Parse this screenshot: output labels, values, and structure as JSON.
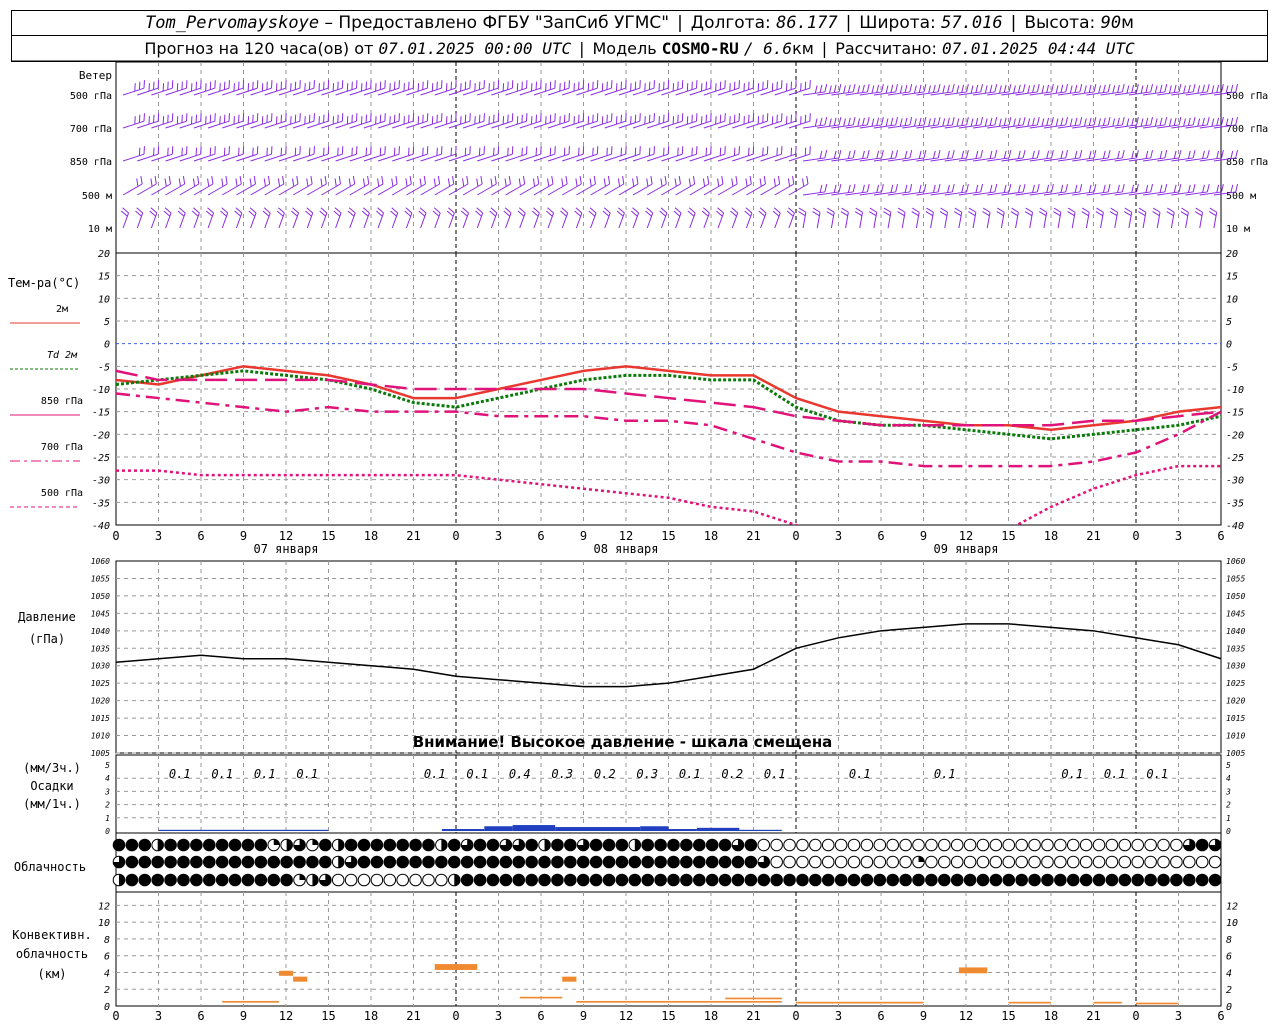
{
  "header": {
    "station": "Tom_Pervomayskoye",
    "provided": "– Предоставлено ФГБУ \"ЗапСиб УГМС\"",
    "lon_label": "Долгота:",
    "lon": "86.177",
    "lat_label": "Широта:",
    "lat": "57.016",
    "alt_label": "Высота:",
    "alt": "90",
    "alt_unit": "м",
    "forecast_label": "Прогноз на 120 часа(ов) от",
    "forecast_start": "07.01.2025 00:00 UTC",
    "model_label": "Модель",
    "model": "COSMO-RU",
    "resolution": "/ 6.6",
    "resolution_unit": "км",
    "calc_label": "Рассчитано:",
    "calc_time": "07.01.2025 04:44 UTC"
  },
  "labels": {
    "wind": "Ветер",
    "wind_levels": [
      "500 гПа",
      "700 гПа",
      "850 гПа",
      "500 м",
      "10  м"
    ],
    "temp_title": "Тем-ра(°С)",
    "legend": [
      "2м",
      "Td  2м",
      "850 гПа",
      "700 гПа",
      "500 гПа"
    ],
    "pressure": "Давление",
    "pressure_unit": "(гПа)",
    "pressure_warning": "Внимание! Высокое давление - шкала смещена",
    "precip_unit_3h": "(мм/3ч.)",
    "precip": "Осадки",
    "precip_unit_1h": "(мм/1ч.)",
    "cloud": "Облачность",
    "conv1": "Конвективн.",
    "conv2": "облачность",
    "conv3": "(км)",
    "days": [
      "07 января",
      "08 января",
      "09 января"
    ]
  },
  "colors": {
    "t2m": "#e8382f",
    "td2m": "#0a7a0a",
    "t850": "#e0137a",
    "t700": "#e0137a",
    "t500": "#e0137a",
    "wind": "#8a2be2",
    "precip": "#2040c0",
    "conv": "#f08a30",
    "zero": "#4060e0"
  },
  "chart_data": [
    {
      "type": "line",
      "title": "Тем-ра(°С)",
      "x": [
        0,
        3,
        6,
        9,
        12,
        15,
        18,
        21,
        24,
        27,
        30,
        33,
        36,
        39,
        42,
        45,
        48,
        51,
        54,
        57,
        60,
        63,
        66,
        69,
        72,
        75,
        78
      ],
      "xticks": [
        "0",
        "3",
        "6",
        "9",
        "12",
        "15",
        "18",
        "21",
        "0",
        "3",
        "6",
        "9",
        "12",
        "15",
        "18",
        "21",
        "0",
        "3",
        "6",
        "9",
        "12",
        "15",
        "18",
        "21",
        "0",
        "3",
        "6"
      ],
      "ylim": [
        -40,
        20
      ],
      "yticks": [
        20,
        15,
        10,
        5,
        0,
        -5,
        -10,
        -15,
        -20,
        -25,
        -30,
        -35,
        -40
      ],
      "series": [
        {
          "name": "2м",
          "values": [
            -8,
            -9,
            -7,
            -5,
            -6,
            -7,
            -9,
            -12,
            -12,
            -10,
            -8,
            -6,
            -5,
            -6,
            -7,
            -7,
            -12,
            -15,
            -16,
            -17,
            -18,
            -18,
            -19,
            -18,
            -17,
            -15,
            -14
          ]
        },
        {
          "name": "Td  2м",
          "values": [
            -9,
            -8,
            -7,
            -6,
            -7,
            -8,
            -10,
            -13,
            -14,
            -12,
            -10,
            -8,
            -7,
            -7,
            -8,
            -8,
            -14,
            -17,
            -18,
            -18,
            -19,
            -20,
            -21,
            -20,
            -19,
            -18,
            -16
          ]
        },
        {
          "name": "850 гПа",
          "values": [
            -6,
            -8,
            -8,
            -8,
            -8,
            -8,
            -9,
            -10,
            -10,
            -10,
            -10,
            -10,
            -11,
            -12,
            -13,
            -14,
            -16,
            -17,
            -18,
            -18,
            -18,
            -18,
            -18,
            -17,
            -17,
            -16,
            -15
          ]
        },
        {
          "name": "700 гПа",
          "values": [
            -11,
            -12,
            -13,
            -14,
            -15,
            -14,
            -15,
            -15,
            -15,
            -16,
            -16,
            -16,
            -17,
            -17,
            -18,
            -21,
            -24,
            -26,
            -26,
            -27,
            -27,
            -27,
            -27,
            -26,
            -24,
            -20,
            -15
          ]
        },
        {
          "name": "500 гПа",
          "values": [
            -28,
            -28,
            -29,
            -29,
            -29,
            -29,
            -29,
            -29,
            -29,
            -30,
            -31,
            -32,
            -33,
            -34,
            -36,
            -37,
            -40,
            -43,
            -44,
            -44,
            -43,
            -41,
            -36,
            -32,
            -29,
            -27,
            -27
          ]
        }
      ]
    },
    {
      "type": "line",
      "title": "Давление",
      "x": [
        0,
        3,
        6,
        9,
        12,
        15,
        18,
        21,
        24,
        27,
        30,
        33,
        36,
        39,
        42,
        45,
        48,
        51,
        54,
        57,
        60,
        63,
        66,
        69,
        72,
        75,
        78
      ],
      "ylim": [
        1005,
        1060
      ],
      "yticks": [
        1060,
        1055,
        1050,
        1045,
        1040,
        1035,
        1030,
        1025,
        1020,
        1015,
        1010,
        1005
      ],
      "series": [
        {
          "name": "",
          "values": [
            1031,
            1032,
            1033,
            1032,
            1032,
            1031,
            1030,
            1029,
            1027,
            1026,
            1025,
            1024,
            1024,
            1025,
            1027,
            1029,
            1035,
            1038,
            1040,
            1041,
            1042,
            1042,
            1041,
            1040,
            1038,
            1036,
            1032
          ]
        }
      ]
    },
    {
      "type": "bar",
      "title": "Осадки",
      "ylim": [
        0,
        5
      ],
      "yticks": [
        5,
        4,
        3,
        2,
        1,
        0
      ],
      "labels3h": [
        {
          "x": 4.5,
          "text": "0.1"
        },
        {
          "x": 7.5,
          "text": "0.1"
        },
        {
          "x": 10.5,
          "text": "0.1"
        },
        {
          "x": 13.5,
          "text": "0.1"
        },
        {
          "x": 22.5,
          "text": "0.1"
        },
        {
          "x": 25.5,
          "text": "0.1"
        },
        {
          "x": 28.5,
          "text": "0.4"
        },
        {
          "x": 31.5,
          "text": "0.3"
        },
        {
          "x": 34.5,
          "text": "0.2"
        },
        {
          "x": 37.5,
          "text": "0.3"
        },
        {
          "x": 40.5,
          "text": "0.1"
        },
        {
          "x": 43.5,
          "text": "0.2"
        },
        {
          "x": 46.5,
          "text": "0.1"
        },
        {
          "x": 52.5,
          "text": "0.1"
        },
        {
          "x": 58.5,
          "text": "0.1"
        },
        {
          "x": 67.5,
          "text": "0.1"
        },
        {
          "x": 70.5,
          "text": "0.1"
        },
        {
          "x": 73.5,
          "text": "0.1"
        }
      ],
      "hourly_mm": [
        {
          "x0": 3,
          "x1": 15,
          "v": 0.03
        },
        {
          "x0": 23,
          "x1": 26,
          "v": 0.05
        },
        {
          "x0": 26,
          "x1": 28,
          "v": 0.12
        },
        {
          "x0": 28,
          "x1": 31,
          "v": 0.15
        },
        {
          "x0": 31,
          "x1": 37,
          "v": 0.1
        },
        {
          "x0": 37,
          "x1": 39,
          "v": 0.12
        },
        {
          "x0": 39,
          "x1": 41,
          "v": 0.05
        },
        {
          "x0": 41,
          "x1": 44,
          "v": 0.08
        },
        {
          "x0": 44,
          "x1": 47,
          "v": 0.03
        }
      ]
    },
    {
      "type": "bar",
      "title": "Конвективн. облачность",
      "ylim": [
        0,
        13
      ],
      "yticks": [
        12,
        10,
        8,
        6,
        4,
        2,
        0
      ],
      "bars": [
        {
          "x0": 11.5,
          "x1": 12.5,
          "y0": 3.6,
          "y1": 4.2
        },
        {
          "x0": 12.5,
          "x1": 13.5,
          "y0": 2.9,
          "y1": 3.5
        },
        {
          "x0": 22.5,
          "x1": 25.5,
          "y0": 4.3,
          "y1": 5.0
        },
        {
          "x0": 31.5,
          "x1": 32.5,
          "y0": 2.9,
          "y1": 3.5
        },
        {
          "x0": 59.5,
          "x1": 61.5,
          "y0": 3.9,
          "y1": 4.6
        },
        {
          "x0": 7.5,
          "x1": 11.5,
          "y0": 0.4,
          "y1": 0.6
        },
        {
          "x0": 28.5,
          "x1": 31.5,
          "y0": 0.9,
          "y1": 1.1
        },
        {
          "x0": 32.5,
          "x1": 47,
          "y0": 0.4,
          "y1": 0.6
        },
        {
          "x0": 43,
          "x1": 47,
          "y0": 0.8,
          "y1": 1.0
        },
        {
          "x0": 48,
          "x1": 57,
          "y0": 0.3,
          "y1": 0.5
        },
        {
          "x0": 63,
          "x1": 66,
          "y0": 0.3,
          "y1": 0.5
        },
        {
          "x0": 69,
          "x1": 71,
          "y0": 0.3,
          "y1": 0.5
        },
        {
          "x0": 72,
          "x1": 75,
          "y0": 0.2,
          "y1": 0.4
        }
      ]
    },
    {
      "type": "table",
      "title": "Облачность",
      "symbol_legend": "F=пасмурно, E=ясно, H=половина, Q=четверть, T=три четверти",
      "rows": [
        "FFFHFFFFFFFFQHTQFHFFFFFFFHFTFFTTFHFFTFFFHFFFFFFFTFEEEEEEEEEEEEEEEEEEEEEEEEEEEEEEEEETFT",
        "TFFFFFFFFFFFFFFFFHTFFFFFFFFFFFFFFFFFFFFFFFFFFFFFFFTEEEEEEEEEEEQEEEEEEEEEEEEEEEEEEEEEEE",
        "HFFFFFFFFFFFFFQHTEEEEEEEEEHFFFFFFFFFFFFFFFFFFFFFFFFFFFFFFFFFFFFFFFFFFFFFFFFFFFFFFFFFFFF"
      ]
    }
  ]
}
